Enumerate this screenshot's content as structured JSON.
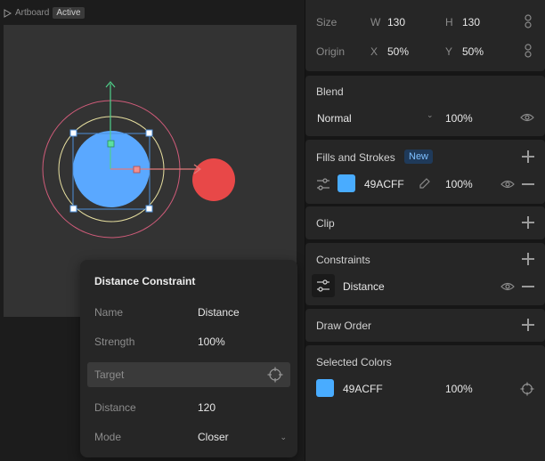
{
  "canvas": {
    "artboard_label": "Artboard",
    "active_badge": "Active"
  },
  "popover": {
    "title": "Distance Constraint",
    "rows": [
      {
        "label": "Name",
        "value": "Distance"
      },
      {
        "label": "Strength",
        "value": "100%"
      },
      {
        "label": "Target",
        "value": ""
      },
      {
        "label": "Distance",
        "value": "120"
      },
      {
        "label": "Mode",
        "value": "Closer"
      }
    ]
  },
  "inspector": {
    "size": {
      "label": "Size",
      "w_label": "W",
      "w_value": "130",
      "h_label": "H",
      "h_value": "130"
    },
    "origin": {
      "label": "Origin",
      "x_label": "X",
      "x_value": "50%",
      "y_label": "Y",
      "y_value": "50%"
    },
    "blend": {
      "title": "Blend",
      "mode": "Normal",
      "opacity": "100%"
    },
    "fills": {
      "title": "Fills and Strokes",
      "badge": "New",
      "hex": "49ACFF",
      "opacity": "100%",
      "color": "#49acff"
    },
    "clip": {
      "title": "Clip"
    },
    "constraints": {
      "title": "Constraints",
      "item": "Distance"
    },
    "draw_order": {
      "title": "Draw Order"
    },
    "selected_colors": {
      "title": "Selected Colors",
      "hex": "49ACFF",
      "opacity": "100%",
      "color": "#49acff"
    }
  },
  "colors": {
    "selected_fill": "#5aa8ff",
    "target_fill": "#e84848",
    "outer_ring": "#d15c7a",
    "inner_ring": "#e8e0a0",
    "y_axis": "#4fd08a",
    "x_axis": "#e27a7a",
    "selection": "#4d8fd8"
  },
  "icons": {
    "eye": "eye-icon",
    "crosshair": "crosshair-icon",
    "link": "link-icon",
    "sliders": "sliders-icon",
    "plus": "plus-icon",
    "minus": "minus-icon"
  }
}
